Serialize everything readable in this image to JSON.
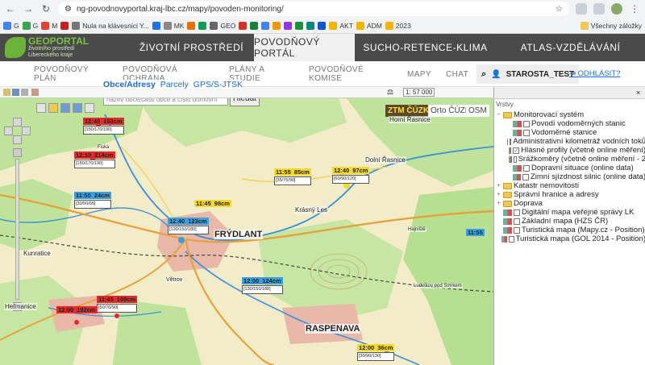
{
  "browser": {
    "url": "ng-povodnovyportal.kraj-lbc.cz/mapy/povoden-monitoring/",
    "bookmarks": [
      "G",
      "G",
      "M",
      "",
      "Nula na klávesnici Y...",
      "",
      "MK",
      "",
      "",
      "GEO",
      "",
      "",
      "",
      "",
      "",
      "",
      "",
      "",
      "AKT",
      "ADM",
      "2023"
    ],
    "all_bookmarks": "Všechny záložky"
  },
  "header": {
    "logo_title": "GEOPORTAL",
    "logo_sub1": "životního prostředí",
    "logo_sub2": "Libereckého kraje",
    "tabs": [
      "ŽIVOTNÍ PROSTŘEDÍ",
      "POVODŇOVÝ PORTÁL",
      "SUCHO-RETENCE-KLIMA",
      "ATLAS-VZDĚLÁVÁNÍ"
    ],
    "active_tab": 1
  },
  "submenu": {
    "items": [
      {
        "l1": "POVODŇOVÝ",
        "l2": "PLÁN"
      },
      {
        "l1": "POVODŇOVÁ",
        "l2": "OCHRANA"
      },
      {
        "l1": "PLÁNY A",
        "l2": "STUDIE"
      },
      {
        "l1": "POVODŇOVÉ",
        "l2": "KOMISE"
      },
      {
        "l1": "MAPY",
        "l2": ""
      },
      {
        "l1": "CHAT",
        "l2": ""
      }
    ],
    "user": "STAROSTA_TEST",
    "logout": "ODHLÁSIT?"
  },
  "search": {
    "modes": [
      "Obce/Adresy",
      "Parcely",
      "GPS/S-JTSK"
    ],
    "placeholder": "název obce/části obce a číslo domovní",
    "button": "Hledat"
  },
  "map": {
    "scale": "1: 57 000",
    "basemaps": [
      "ZTM ČÚZK",
      "Orto ČÚZK",
      "OSM"
    ],
    "places": [
      "FRÝDLANT",
      "RASPENAVA",
      "Kunratice",
      "Heřmanice",
      "Krásný Les",
      "Horní Řasnice",
      "Dolní Řasnice",
      "Ludvíkov pod Smrkem",
      "Větrov",
      "Hajniště",
      "Fiska"
    ],
    "gauges": [
      {
        "time": "12:40",
        "value": "193cm",
        "sub": "[150/170/190]",
        "color": "#e32b2b"
      },
      {
        "time": "12:10",
        "value": "214cm",
        "sub": "[150/170/190]",
        "color": "#e32b2b"
      },
      {
        "time": "11:50",
        "value": "24cm",
        "sub": "[30/50/65]",
        "color": "#3aa0e0"
      },
      {
        "time": "11:45",
        "value": "98cm",
        "sub": "",
        "color": "#f6d92c"
      },
      {
        "time": "12:40",
        "value": "123cm",
        "sub": "[130/150/180]",
        "color": "#3aa0e0"
      },
      {
        "time": "11:55",
        "value": "85cm",
        "sub": "[35/75/90]",
        "color": "#f6d92c"
      },
      {
        "time": "12:40",
        "value": "97cm",
        "sub": "[60/90/120]",
        "color": "#f6d92c"
      },
      {
        "time": "12:00",
        "value": "124cm",
        "sub": "[130/150/180]",
        "color": "#3aa0e0"
      },
      {
        "time": "11:55",
        "value": "",
        "sub": "",
        "color": "#3aa0e0"
      },
      {
        "time": "11:45",
        "value": "109cm",
        "sub": "[60/70/90]",
        "color": "#e32b2b"
      },
      {
        "time": "12:00",
        "value": "192cm",
        "sub": "",
        "color": "#e32b2b"
      },
      {
        "time": "12:00",
        "value": "36cm",
        "sub": "[30/90/130]",
        "color": "#f6d92c"
      }
    ]
  },
  "layers": {
    "title": "Vrstvy",
    "nodes": [
      {
        "label": "Monitorovací systém",
        "level": 0,
        "type": "folder",
        "exp": "−"
      },
      {
        "label": "Povodí vodoměrných stanic",
        "level": 1,
        "type": "layer",
        "checked": false
      },
      {
        "label": "Vodoměrné stanice",
        "level": 1,
        "type": "layer",
        "checked": false
      },
      {
        "label": "Administrativní kilometráž vodních toků",
        "level": 1,
        "type": "layer",
        "checked": false
      },
      {
        "label": "Hlásné profily (včetně online měření)",
        "level": 1,
        "type": "layer",
        "checked": true
      },
      {
        "label": "Srážkoměry (včetně online měření - 2",
        "level": 1,
        "type": "layer",
        "checked": false
      },
      {
        "label": "Dopravní situace (online data)",
        "level": 1,
        "type": "layer",
        "checked": false
      },
      {
        "label": "Zimní sjízdnost silnic (online data)",
        "level": 1,
        "type": "layer",
        "checked": false
      },
      {
        "label": "Katastr nemovitostí",
        "level": 0,
        "type": "folder",
        "exp": "+"
      },
      {
        "label": "Správní hranice a adresy",
        "level": 0,
        "type": "folder",
        "exp": "+"
      },
      {
        "label": "Doprava",
        "level": 0,
        "type": "folder",
        "exp": "+"
      },
      {
        "label": "Digitální mapa veřejné správy LK",
        "level": 0,
        "type": "layer",
        "checked": false
      },
      {
        "label": "Základní mapa (HZS ČR)",
        "level": 0,
        "type": "layer",
        "checked": false
      },
      {
        "label": "Turistická mapa (Mapy.cz - Position)",
        "level": 0,
        "type": "layer",
        "checked": false
      },
      {
        "label": "Turistická mapa (GOL 2014 - Position)",
        "level": 0,
        "type": "layer",
        "checked": false
      }
    ]
  }
}
